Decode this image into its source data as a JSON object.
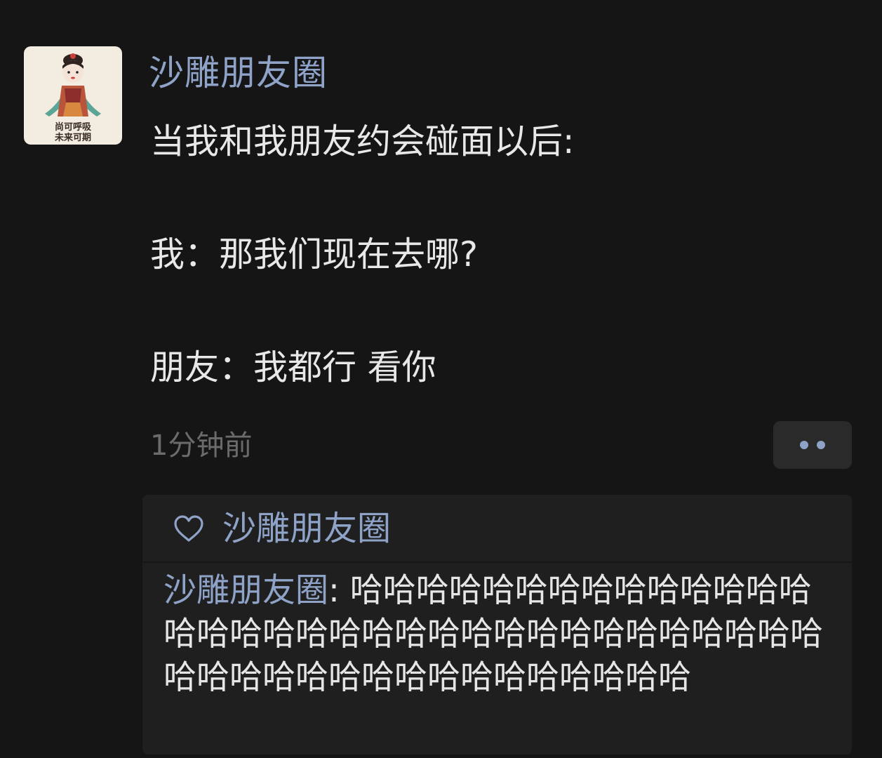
{
  "post": {
    "avatar": {
      "line1": "尚可呼吸",
      "line2": "未来可期"
    },
    "username": "沙雕朋友圈",
    "intro": "当我和我朋友约会碰面以后:",
    "me_line": "我：那我们现在去哪?",
    "friend_line": "朋友：我都行 看你",
    "timestamp": "1分钟前",
    "more_icon": "more-dots-icon"
  },
  "reactions": {
    "like_icon": "heart-icon",
    "likes": "沙雕朋友圈",
    "comment": {
      "author": "沙雕朋友圈",
      "separator": ": ",
      "text": "哈哈哈哈哈哈哈哈哈哈哈哈哈哈哈哈哈哈哈哈哈哈哈哈哈哈哈哈哈哈哈哈哈哈哈哈哈哈哈哈哈哈哈哈哈哈哈哈哈哈"
    }
  },
  "colors": {
    "background": "#151515",
    "link_blue": "#8ea3c7",
    "panel": "#1f1f1f",
    "timestamp_gray": "#6b6b6b"
  }
}
